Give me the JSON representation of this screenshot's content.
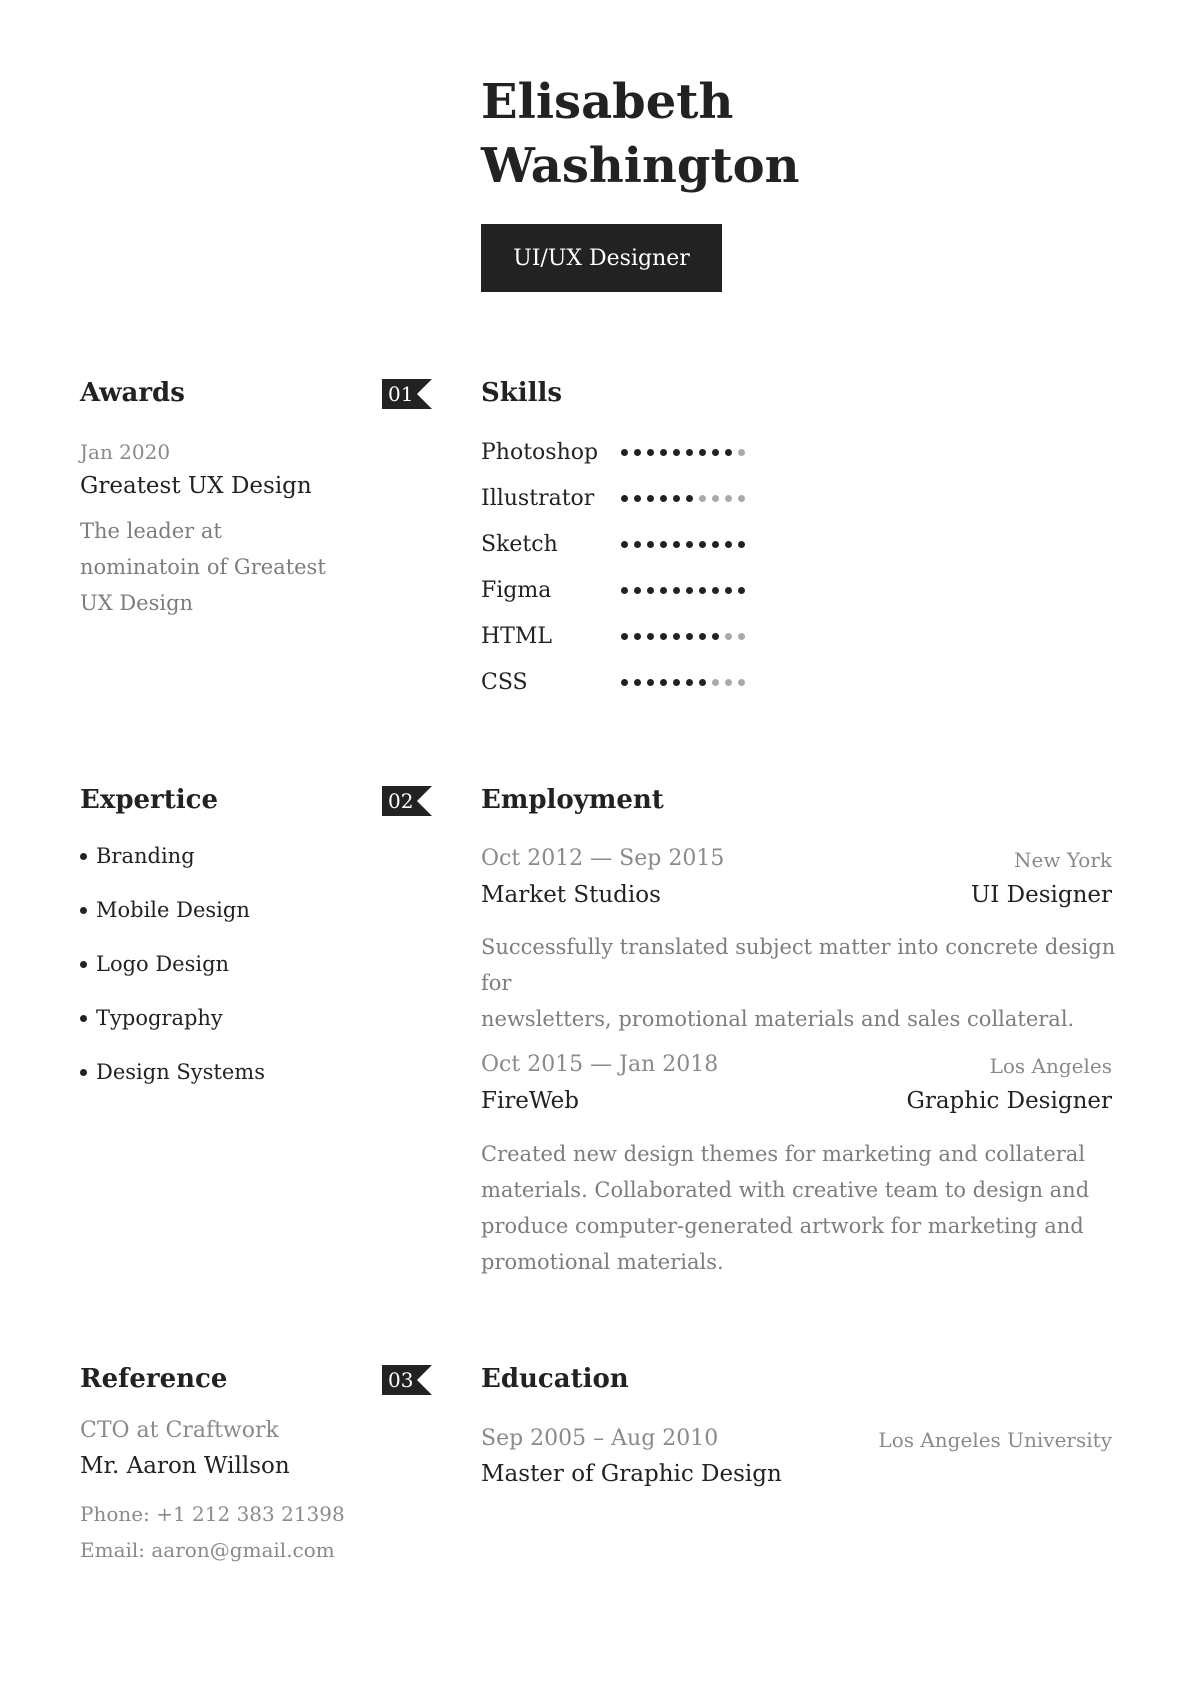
{
  "header": {
    "first_name": "Elisabeth",
    "last_name": "Washington",
    "job_title": "UI/UX Designer"
  },
  "awards": {
    "title": "Awards",
    "badge": "01",
    "date": "Jan 2020",
    "name": "Greatest UX Design",
    "description_lines": [
      "The leader at",
      "nominatoin of Greatest",
      "UX Design"
    ]
  },
  "skills": {
    "title": "Skills",
    "items": [
      {
        "name": "Photoshop",
        "level": 9,
        "max": 10
      },
      {
        "name": "Illustrator",
        "level": 6,
        "max": 10
      },
      {
        "name": "Sketch",
        "level": 10,
        "max": 10
      },
      {
        "name": "Figma",
        "level": 10,
        "max": 10
      },
      {
        "name": "HTML",
        "level": 8,
        "max": 10
      },
      {
        "name": "CSS",
        "level": 7,
        "max": 10
      }
    ]
  },
  "expertise": {
    "title": "Expertice",
    "badge": "02",
    "items": [
      "Branding",
      "Mobile Design",
      "Logo Design",
      "Typography",
      "Design Systems"
    ]
  },
  "employment": {
    "title": "Employment",
    "jobs": [
      {
        "dates": "Oct 2012 — Sep 2015",
        "location": "New York",
        "company": "Market Studios",
        "role": "UI Designer",
        "description_lines": [
          "Successfully translated subject matter into concrete design for",
          "newsletters, promotional materials and sales collateral."
        ]
      },
      {
        "dates": "Oct 2015 — Jan 2018",
        "location": "Los Angeles",
        "company": "FireWeb",
        "role": "Graphic Designer",
        "description_lines": [
          "Created new design themes for marketing and collateral",
          "materials. Collaborated with creative team to design and",
          "produce computer-generated artwork for marketing and",
          "promotional materials."
        ]
      }
    ]
  },
  "reference": {
    "title": "Reference",
    "badge": "03",
    "position": "CTO at Craftwork",
    "name": "Mr. Aaron Willson",
    "phone": "Phone: +1 212 383 21398",
    "email": "Email: aaron@gmail.com"
  },
  "education": {
    "title": "Education",
    "dates": "Sep 2005 – Aug 2010",
    "school": "Los Angeles University",
    "degree": "Master of Graphic Design"
  },
  "colors": {
    "text": "#222222",
    "muted": "#8a8a8a",
    "dot_off": "#aaaaaa",
    "accent_bg": "#222222"
  }
}
